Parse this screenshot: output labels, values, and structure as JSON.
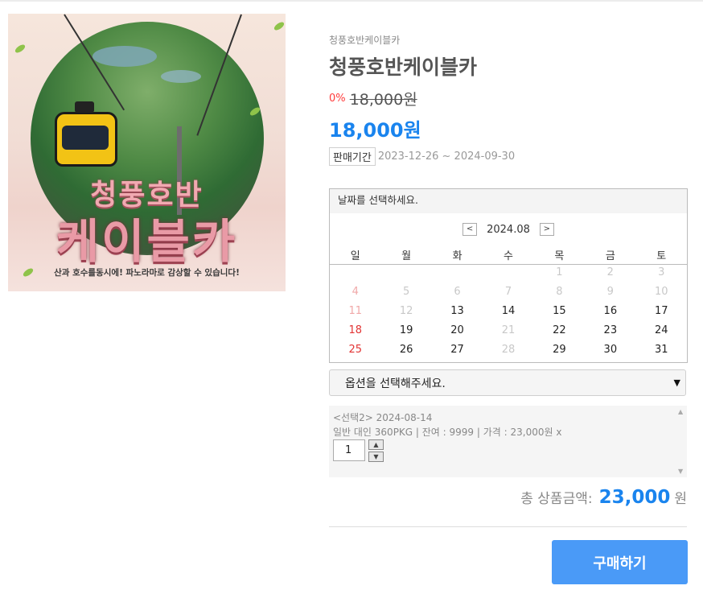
{
  "product": {
    "image_title_line1": "청풍호반",
    "image_title_line2": "케이블카",
    "image_caption": "산과 호수를동시에! 파노라마로 감상할 수 있습니다!",
    "brand": "청풍호반케이블카",
    "name": "청풍호반케이블카",
    "discount_rate": "0%",
    "original_price": "18,000원",
    "price": "18,000원",
    "period_label": "판매기간",
    "period_value": "2023-12-26 ~ 2024-09-30"
  },
  "calendar": {
    "header": "날짜를 선택하세요.",
    "prev_icon": "<",
    "next_icon": ">",
    "month": "2024.08",
    "weekdays": [
      "일",
      "월",
      "화",
      "수",
      "목",
      "금",
      "토"
    ],
    "weeks": [
      [
        "",
        "",
        "",
        "",
        "1",
        "2",
        "3"
      ],
      [
        "4",
        "5",
        "6",
        "7",
        "8",
        "9",
        "10"
      ],
      [
        "11",
        "12",
        "13",
        "14",
        "15",
        "16",
        "17"
      ],
      [
        "18",
        "19",
        "20",
        "21",
        "22",
        "23",
        "24"
      ],
      [
        "25",
        "26",
        "27",
        "28",
        "29",
        "30",
        "31"
      ]
    ],
    "available_days": [
      "13",
      "14",
      "15",
      "16",
      "17",
      "18",
      "19",
      "20",
      "22",
      "23",
      "24",
      "25",
      "26",
      "27",
      "29",
      "30",
      "31"
    ]
  },
  "option_select": {
    "placeholder": "옵션을 선택해주세요."
  },
  "selected": {
    "line1": "<선택2> 2024-08-14",
    "line2": "일반 대인 360PKG | 잔여 : 9999 | 가격 : 23,000원 x",
    "quantity": "1",
    "up_icon": "▲",
    "down_icon": "▼"
  },
  "total": {
    "label": "총 상품금액:",
    "amount": "23,000",
    "unit": "원"
  },
  "buy_button": "구매하기",
  "colors": {
    "accent": "#1a84ee",
    "buy_button": "#4a9af7",
    "discount": "#ff3b3b",
    "sunday": "#e23434"
  }
}
